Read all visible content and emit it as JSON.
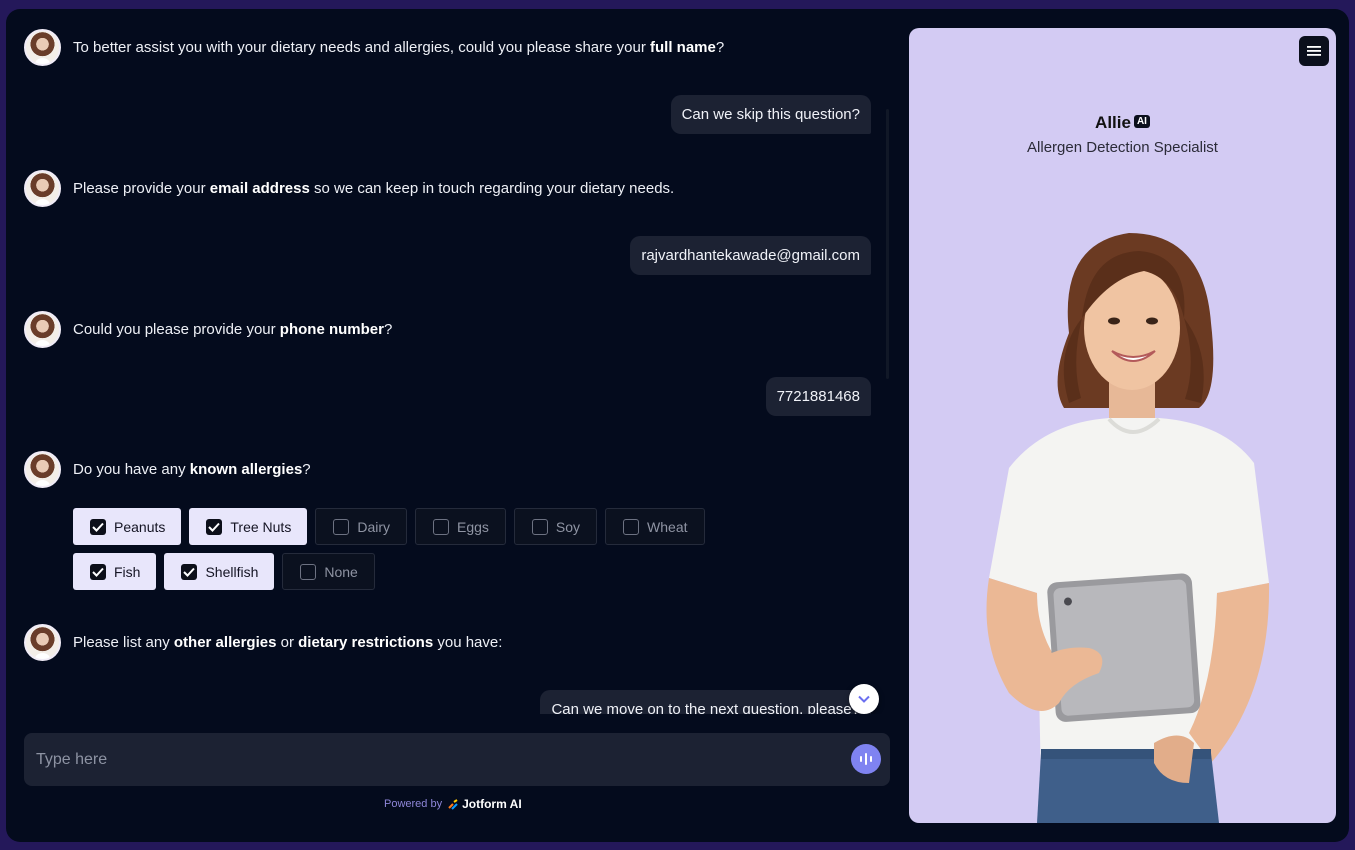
{
  "chat": {
    "messages": [
      {
        "role": "bot",
        "parts": [
          {
            "t": "To better assist you with your dietary needs and allergies, could you please share your "
          },
          {
            "t": "full name",
            "b": true
          },
          {
            "t": "?"
          }
        ]
      },
      {
        "role": "user",
        "text": "Can we skip this question?"
      },
      {
        "role": "bot",
        "parts": [
          {
            "t": "Please provide your "
          },
          {
            "t": "email address",
            "b": true
          },
          {
            "t": " so we can keep in touch regarding your dietary needs."
          }
        ]
      },
      {
        "role": "user",
        "text": "rajvardhantekawade@gmail.com"
      },
      {
        "role": "bot",
        "parts": [
          {
            "t": "Could you please provide your "
          },
          {
            "t": "phone number",
            "b": true
          },
          {
            "t": "?"
          }
        ]
      },
      {
        "role": "user",
        "text": "7721881468"
      },
      {
        "role": "bot",
        "parts": [
          {
            "t": "Do you have any "
          },
          {
            "t": "known allergies",
            "b": true
          },
          {
            "t": "?"
          }
        ]
      },
      {
        "role": "bot",
        "parts": [
          {
            "t": "Please list any "
          },
          {
            "t": "other allergies",
            "b": true
          },
          {
            "t": " or "
          },
          {
            "t": "dietary restrictions",
            "b": true
          },
          {
            "t": " you have:"
          }
        ]
      },
      {
        "role": "user",
        "text": "Can we move on to the next question, please?"
      }
    ],
    "allergy_options": [
      {
        "label": "Peanuts",
        "checked": true
      },
      {
        "label": "Tree Nuts",
        "checked": true
      },
      {
        "label": "Dairy",
        "checked": false
      },
      {
        "label": "Eggs",
        "checked": false
      },
      {
        "label": "Soy",
        "checked": false
      },
      {
        "label": "Wheat",
        "checked": false
      },
      {
        "label": "Fish",
        "checked": true
      },
      {
        "label": "Shellfish",
        "checked": true
      },
      {
        "label": "None",
        "checked": false
      }
    ]
  },
  "input": {
    "placeholder": "Type here",
    "value": ""
  },
  "footer": {
    "powered_by": "Powered by",
    "brand": "Jotform AI"
  },
  "agent": {
    "name": "Allie",
    "badge": "AI",
    "role": "Allergen Detection Specialist"
  },
  "colors": {
    "background": "#040b1d",
    "panel": "#d3cbf3",
    "accent": "#7f83f1",
    "chip_selected": "#e8e6fb"
  },
  "icons": [
    "avatar",
    "check-icon",
    "chevron-down-icon",
    "microphone-icon",
    "menu-icon",
    "jotform-logo-icon"
  ]
}
